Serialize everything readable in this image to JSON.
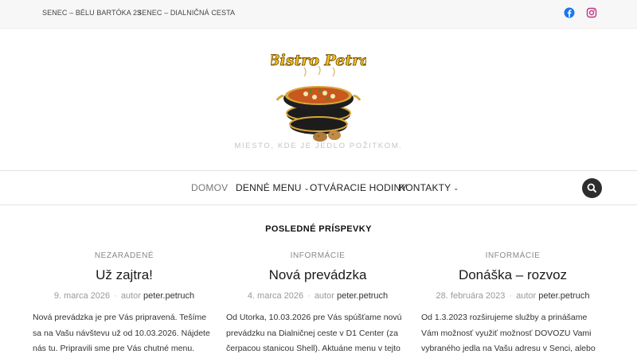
{
  "topbar": {
    "links": [
      "SENEC – BÉLU BARTÓKA 23",
      "SENEC – DIALNIČNÁ CESTA"
    ],
    "social": [
      {
        "icon": "facebook-icon",
        "color": "#1877f2"
      },
      {
        "icon": "instagram-icon",
        "color": "#c13584"
      }
    ]
  },
  "header": {
    "logo_text": "Bistro Petra",
    "tagline": "MIESTO, KDE JE JEDLO POŽITKOM."
  },
  "nav": {
    "items": [
      {
        "label": "DOMOV",
        "active": true
      },
      {
        "label": "DENNÉ MENU",
        "dropdown": true
      },
      {
        "label": "OTVÁRACIE HODINY"
      },
      {
        "label": "KONTAKTY",
        "dropdown": true
      }
    ],
    "search_icon": "search-icon"
  },
  "section": {
    "title": "POSLEDNÉ PRÍSPEVKY"
  },
  "posts": [
    {
      "category": "NEZARADENÉ",
      "title": "Už zajtra!",
      "date": "9. marca 2026",
      "author_prefix": "autor",
      "author": "peter.petruch",
      "excerpt": "Nová prevádzka je pre Vás pripravená. Tešíme sa na Vašu návštevu už od 10.03.2026. Nájdete nás tu. Pripravili sme pre Vás chutné menu."
    },
    {
      "category": "INFORMÁCIE",
      "title": "Nová prevádzka",
      "date": "4. marca 2026",
      "author_prefix": "autor",
      "author": "peter.petruch",
      "excerpt": "Od Utorka, 10.03.2026 pre Vás spúšťame novú prevádzku na Dialničnej ceste v D1 Center (za čerpacou stanicou Shell). Aktuáne menu v tejto"
    },
    {
      "category": "INFORMÁCIE",
      "title": "Donáška – rozvoz",
      "date": "28. februára 2023",
      "author_prefix": "autor",
      "author": "peter.petruch",
      "excerpt": "Od 1.3.2023 rozširujeme služby a prinášame Vám možnosť využiť možnosť DOVOZU Vami vybraného jedla na Vašu adresu v Senci, alebo"
    }
  ]
}
